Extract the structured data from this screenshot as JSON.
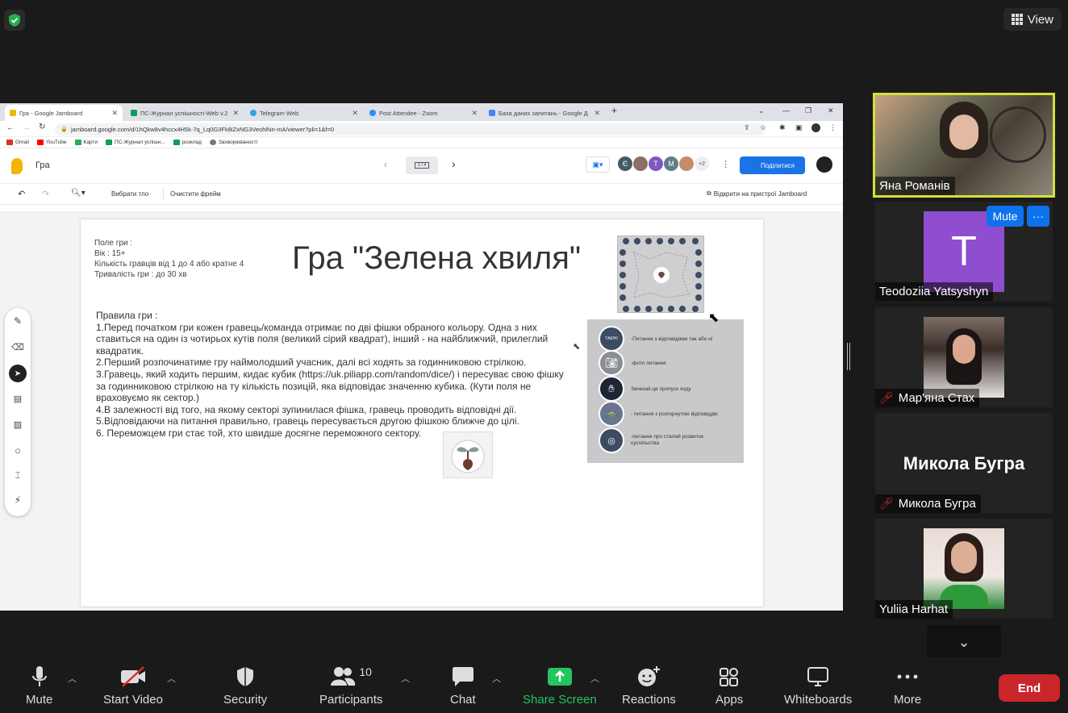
{
  "view_label": "View",
  "browser": {
    "tabs": [
      {
        "label": "Гра - Google Jamboard",
        "color": "#f4b400"
      },
      {
        "label": "ПС-Журнал успішності-Web v.2",
        "color": "#0f9d58"
      },
      {
        "label": "Telegram Web",
        "color": "#2ca5e0"
      },
      {
        "label": "Post Attendee - Zoom",
        "color": "#2d8cff"
      },
      {
        "label": "База даних запитань - Google Д",
        "color": "#4285f4"
      }
    ],
    "url": "jamboard.google.com/d/1hQkw8v4hccx4H5k-7q_Lq0G3Fk8iZxNG3VeohlNn-mA/viewer?pli=1&f=0",
    "bookmarks": [
      {
        "label": "Gmail",
        "color": "#d93025"
      },
      {
        "label": "YouTube",
        "color": "#ff0000"
      },
      {
        "label": "Карти",
        "color": "#34a853"
      },
      {
        "label": "ПС-Журнал успішн...",
        "color": "#0f9d58"
      },
      {
        "label": "розклад",
        "color": "#0f9d58"
      },
      {
        "label": "Захворюваності",
        "color": "#777777"
      }
    ]
  },
  "jamboard": {
    "title": "Гра",
    "page_indicator": "1 / 4",
    "collaborators": [
      "Є",
      "",
      "T",
      "M",
      ""
    ],
    "more_count": "+2",
    "share_label": "Поділитися",
    "set_background": "Вибрати тло",
    "clear_frame": "Очистити фрейм",
    "open_on_device": "Відкрити на пристрої Jamboard"
  },
  "slide": {
    "info": [
      "Поле гри :",
      "Вік : 15+",
      "Кількість гравців від 1 до 4 або кратне 4",
      "Тривалість гри : до 30 хв"
    ],
    "title": "Гра \"Зелена хвиля\"",
    "rules": [
      "Правила гри :",
      "1.Перед початком гри кожен гравець/команда отримає по дві фішки обраного кольору. Одна з них ставиться на один із чотирьох кутів поля (великий сірий квадрат), інший - на найближчий, прилеглий квадратик.",
      "2.Перший розпочинатиме гру наймолодший учасник, далі всі ходять за годинниковою стрілкою.",
      "3.Гравець, який ходить першим, кидає кубик (https://uk.piliapp.com/random/dice/) і пересуває свою фішку за годинниковою стрілкою на ту кількість позицій, яка відповідає значенню кубика. (Кути поля не враховуємо як сектор.)",
      "4.В залежності від того, на якому секторі зупинилася фішка, гравець проводить відповідні дії.",
      "5.Відповідаючи на питання правильно, гравець пересувається другою фішкою ближче до цілі.",
      "6. Переможцем гри стає той, хто швидше досягне переможного сектору."
    ],
    "legend": [
      {
        "icon": "ТАК/НІ",
        "text": "-Питання з відповідями так або ні"
      },
      {
        "icon": "camera",
        "text": "-фото питання"
      },
      {
        "icon": "hand",
        "text": "Зачекай,це пропуск ходу"
      },
      {
        "icon": "book",
        "text": "- питання з розгорнутою відповіддю"
      },
      {
        "icon": "globe",
        "text": "-питання про сталий розвиток суспільства"
      }
    ]
  },
  "participants": [
    {
      "name": "Яна Романів",
      "active": true,
      "muted": false
    },
    {
      "name": "Teodoziia Yatsyshyn",
      "initial": "T",
      "muted": false
    },
    {
      "name": "Мар'яна Стах",
      "muted": true
    },
    {
      "name": "Микола Бугра",
      "muted": true,
      "big_name": "Микола Бугра"
    },
    {
      "name": "Yuliia Harhat",
      "muted": false
    }
  ],
  "hover_mute": "Mute",
  "hover_more": "···",
  "toolbar": {
    "mute": "Mute",
    "start_video": "Start Video",
    "security": "Security",
    "participants": "Participants",
    "participants_count": "10",
    "chat": "Chat",
    "share_screen": "Share Screen",
    "reactions": "Reactions",
    "apps": "Apps",
    "whiteboards": "Whiteboards",
    "more": "More",
    "end": "End"
  }
}
